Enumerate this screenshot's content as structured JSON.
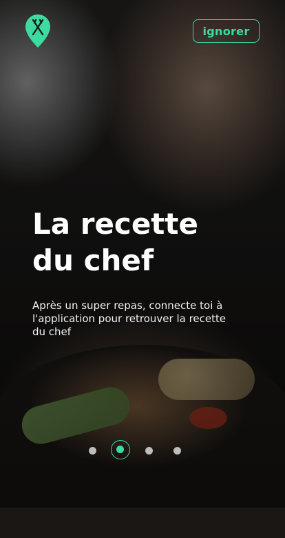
{
  "header": {
    "skip_label": "ignorer"
  },
  "slide": {
    "title_line1": "La recette",
    "title_line2": "du chef",
    "description": "Après un super repas, connecte toi à l'application pour retrouver la recette du chef"
  },
  "pagination": {
    "count": 4,
    "active_index": 1
  },
  "colors": {
    "accent": "#3ddba0",
    "inactive_dot": "#bdbdbd",
    "text": "#ffffff"
  },
  "icons": {
    "logo": "fork-knife-pin-icon"
  }
}
